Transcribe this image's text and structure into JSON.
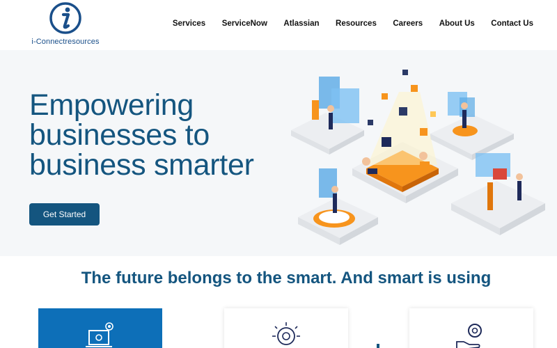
{
  "brand": {
    "logo_text": "i-Connectresources",
    "logo_icon": "i-letter-circle-logo",
    "primary_color": "#14557f",
    "accent_color": "#f7941d"
  },
  "nav": {
    "items": [
      {
        "label": "Services"
      },
      {
        "label": "ServiceNow"
      },
      {
        "label": "Atlassian"
      },
      {
        "label": "Resources"
      },
      {
        "label": "Careers"
      },
      {
        "label": "About Us"
      },
      {
        "label": "Contact Us"
      }
    ]
  },
  "hero": {
    "title": "Empowering businesses to business smarter",
    "cta_label": "Get Started",
    "illustration": "isometric-business-team-illustration"
  },
  "section": {
    "tagline": "The future belongs to the smart. And smart is using",
    "cards": [
      {
        "icon": "laptop-gear-icon",
        "active": true
      },
      {
        "icon": "lightbulb-gear-icon",
        "active": false
      },
      {
        "icon": "hand-gear-icon",
        "active": false
      }
    ]
  }
}
